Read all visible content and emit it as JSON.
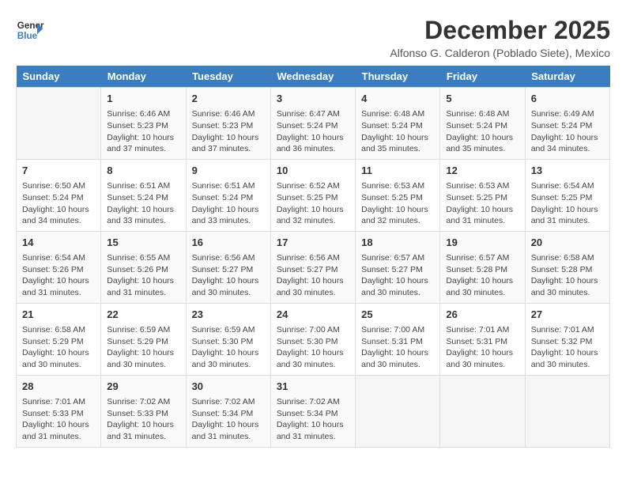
{
  "header": {
    "logo_line1": "General",
    "logo_line2": "Blue",
    "month": "December 2025",
    "location": "Alfonso G. Calderon (Poblado Siete), Mexico"
  },
  "days_of_week": [
    "Sunday",
    "Monday",
    "Tuesday",
    "Wednesday",
    "Thursday",
    "Friday",
    "Saturday"
  ],
  "weeks": [
    [
      {
        "day": "",
        "info": ""
      },
      {
        "day": "1",
        "info": "Sunrise: 6:46 AM\nSunset: 5:23 PM\nDaylight: 10 hours\nand 37 minutes."
      },
      {
        "day": "2",
        "info": "Sunrise: 6:46 AM\nSunset: 5:23 PM\nDaylight: 10 hours\nand 37 minutes."
      },
      {
        "day": "3",
        "info": "Sunrise: 6:47 AM\nSunset: 5:24 PM\nDaylight: 10 hours\nand 36 minutes."
      },
      {
        "day": "4",
        "info": "Sunrise: 6:48 AM\nSunset: 5:24 PM\nDaylight: 10 hours\nand 35 minutes."
      },
      {
        "day": "5",
        "info": "Sunrise: 6:48 AM\nSunset: 5:24 PM\nDaylight: 10 hours\nand 35 minutes."
      },
      {
        "day": "6",
        "info": "Sunrise: 6:49 AM\nSunset: 5:24 PM\nDaylight: 10 hours\nand 34 minutes."
      }
    ],
    [
      {
        "day": "7",
        "info": "Sunrise: 6:50 AM\nSunset: 5:24 PM\nDaylight: 10 hours\nand 34 minutes."
      },
      {
        "day": "8",
        "info": "Sunrise: 6:51 AM\nSunset: 5:24 PM\nDaylight: 10 hours\nand 33 minutes."
      },
      {
        "day": "9",
        "info": "Sunrise: 6:51 AM\nSunset: 5:24 PM\nDaylight: 10 hours\nand 33 minutes."
      },
      {
        "day": "10",
        "info": "Sunrise: 6:52 AM\nSunset: 5:25 PM\nDaylight: 10 hours\nand 32 minutes."
      },
      {
        "day": "11",
        "info": "Sunrise: 6:53 AM\nSunset: 5:25 PM\nDaylight: 10 hours\nand 32 minutes."
      },
      {
        "day": "12",
        "info": "Sunrise: 6:53 AM\nSunset: 5:25 PM\nDaylight: 10 hours\nand 31 minutes."
      },
      {
        "day": "13",
        "info": "Sunrise: 6:54 AM\nSunset: 5:25 PM\nDaylight: 10 hours\nand 31 minutes."
      }
    ],
    [
      {
        "day": "14",
        "info": "Sunrise: 6:54 AM\nSunset: 5:26 PM\nDaylight: 10 hours\nand 31 minutes."
      },
      {
        "day": "15",
        "info": "Sunrise: 6:55 AM\nSunset: 5:26 PM\nDaylight: 10 hours\nand 31 minutes."
      },
      {
        "day": "16",
        "info": "Sunrise: 6:56 AM\nSunset: 5:27 PM\nDaylight: 10 hours\nand 30 minutes."
      },
      {
        "day": "17",
        "info": "Sunrise: 6:56 AM\nSunset: 5:27 PM\nDaylight: 10 hours\nand 30 minutes."
      },
      {
        "day": "18",
        "info": "Sunrise: 6:57 AM\nSunset: 5:27 PM\nDaylight: 10 hours\nand 30 minutes."
      },
      {
        "day": "19",
        "info": "Sunrise: 6:57 AM\nSunset: 5:28 PM\nDaylight: 10 hours\nand 30 minutes."
      },
      {
        "day": "20",
        "info": "Sunrise: 6:58 AM\nSunset: 5:28 PM\nDaylight: 10 hours\nand 30 minutes."
      }
    ],
    [
      {
        "day": "21",
        "info": "Sunrise: 6:58 AM\nSunset: 5:29 PM\nDaylight: 10 hours\nand 30 minutes."
      },
      {
        "day": "22",
        "info": "Sunrise: 6:59 AM\nSunset: 5:29 PM\nDaylight: 10 hours\nand 30 minutes."
      },
      {
        "day": "23",
        "info": "Sunrise: 6:59 AM\nSunset: 5:30 PM\nDaylight: 10 hours\nand 30 minutes."
      },
      {
        "day": "24",
        "info": "Sunrise: 7:00 AM\nSunset: 5:30 PM\nDaylight: 10 hours\nand 30 minutes."
      },
      {
        "day": "25",
        "info": "Sunrise: 7:00 AM\nSunset: 5:31 PM\nDaylight: 10 hours\nand 30 minutes."
      },
      {
        "day": "26",
        "info": "Sunrise: 7:01 AM\nSunset: 5:31 PM\nDaylight: 10 hours\nand 30 minutes."
      },
      {
        "day": "27",
        "info": "Sunrise: 7:01 AM\nSunset: 5:32 PM\nDaylight: 10 hours\nand 30 minutes."
      }
    ],
    [
      {
        "day": "28",
        "info": "Sunrise: 7:01 AM\nSunset: 5:33 PM\nDaylight: 10 hours\nand 31 minutes."
      },
      {
        "day": "29",
        "info": "Sunrise: 7:02 AM\nSunset: 5:33 PM\nDaylight: 10 hours\nand 31 minutes."
      },
      {
        "day": "30",
        "info": "Sunrise: 7:02 AM\nSunset: 5:34 PM\nDaylight: 10 hours\nand 31 minutes."
      },
      {
        "day": "31",
        "info": "Sunrise: 7:02 AM\nSunset: 5:34 PM\nDaylight: 10 hours\nand 31 minutes."
      },
      {
        "day": "",
        "info": ""
      },
      {
        "day": "",
        "info": ""
      },
      {
        "day": "",
        "info": ""
      }
    ]
  ]
}
